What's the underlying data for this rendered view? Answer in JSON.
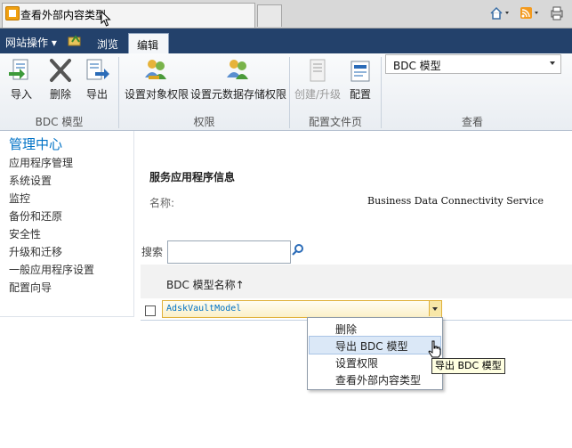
{
  "browser": {
    "tab_title": "查看外部内容类型",
    "commands": [
      "home-icon",
      "rss-icon",
      "print-icon"
    ]
  },
  "ribbon_tabs": {
    "site_actions": "网站操作",
    "browse": "浏览",
    "edit": "编辑"
  },
  "ribbon": {
    "buttons": {
      "import": "导入",
      "delete": "删除",
      "export": "导出",
      "set_object_permissions": "设置对象权限",
      "set_metadata_permissions": "设置元数据存储权限",
      "create_upgrade": "创建/升级",
      "configure": "配置"
    },
    "groups": {
      "bdc_model": "BDC 模型",
      "permissions": "权限",
      "profile_pages": "配置文件页",
      "view": "查看"
    },
    "view_select": "BDC 模型"
  },
  "leftnav": {
    "title": "管理中心",
    "items": [
      "应用程序管理",
      "系统设置",
      "监控",
      "备份和还原",
      "安全性",
      "升级和迁移",
      "一般应用程序设置",
      "配置向导"
    ]
  },
  "main": {
    "section_title": "服务应用程序信息",
    "name_label": "名称:",
    "name_value": "Business Data Connectivity Service",
    "search_label": "搜索",
    "search_value": "",
    "column_header": "BDC 模型名称↑",
    "rows": [
      {
        "name": "AdskVaultModel"
      }
    ]
  },
  "context_menu": {
    "items": [
      "删除",
      "导出 BDC 模型",
      "设置权限",
      "查看外部内容类型"
    ],
    "highlighted_index": 1
  },
  "tooltip": "导出 BDC 模型",
  "colors": {
    "ribbon_bar": "#23416b",
    "accent_link": "#0072c6",
    "selected_row": "#fbf0c8"
  }
}
